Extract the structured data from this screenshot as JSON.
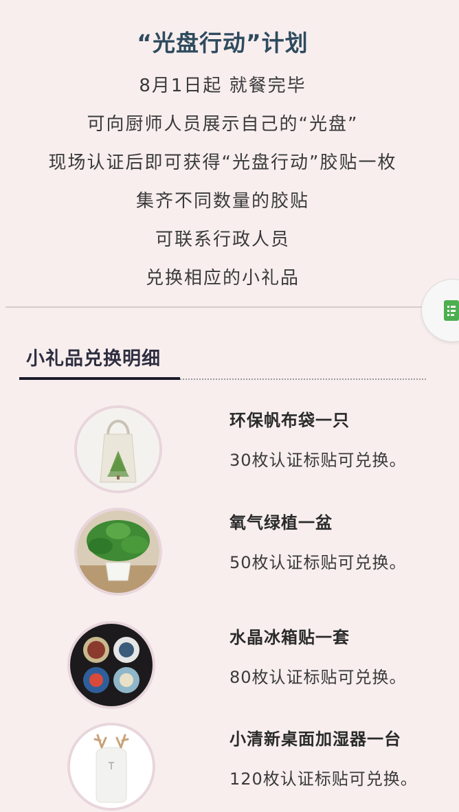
{
  "intro": {
    "title": "“光盘行动”计划",
    "lines": [
      "8月1日起 就餐完毕",
      "可向厨师人员展示自己的“光盘”",
      "现场认证后即可获得“光盘行动”胶贴一枚",
      "集齐不同数量的胶贴",
      "可联系行政人员",
      "兑换相应的小礼品"
    ]
  },
  "side_button": {
    "icon": "document-icon",
    "color": "#4caf50"
  },
  "section": {
    "title": "小礼品兑换明细"
  },
  "gifts": [
    {
      "name": "环保帆布袋一只",
      "desc": "30枚认证标贴可兑换。",
      "image": "tote-bag-image"
    },
    {
      "name": "氧气绿植一盆",
      "desc": "50枚认证标贴可兑换。",
      "image": "potted-plant-image"
    },
    {
      "name": "水晶冰箱贴一套",
      "desc": "80枚认证标贴可兑换。",
      "image": "fridge-magnets-image"
    },
    {
      "name": "小清新桌面加湿器一台",
      "desc": "120枚认证标贴可兑换。",
      "image": "humidifier-image"
    }
  ],
  "colors": {
    "background": "#f8eeee",
    "title": "#2e4b5e",
    "accent_green": "#4caf50"
  }
}
